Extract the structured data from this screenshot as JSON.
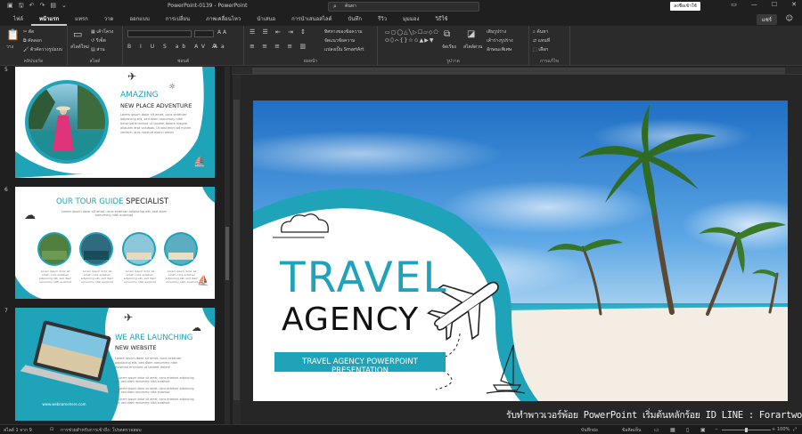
{
  "titlebar": {
    "title": "PowerPoint-0139  -  PowerPoint",
    "search_placeholder": "ค้นหา",
    "signin": "ลงชื่อเข้าใช้"
  },
  "tabs": [
    "ไฟล์",
    "หน้าแรก",
    "แทรก",
    "วาด",
    "ออกแบบ",
    "การเปลี่ยน",
    "ภาพเคลื่อนไหว",
    "นำเสนอ",
    "การนำเสนอสไลด์",
    "บันทึก",
    "รีวิว",
    "มุมมอง",
    "วิธีใช้"
  ],
  "active_tab": "หน้าแรก",
  "share_label": "แชร์",
  "ribbon": {
    "clipboard": {
      "paste": "วาง",
      "cut": "ตัด",
      "copy": "คัดลอก",
      "format_painter": "ตัวคัดวางรูปแบบ",
      "label": "คลิปบอร์ด"
    },
    "slides": {
      "new_slide": "สไลด์ใหม่",
      "layout": "เค้าโครง",
      "reset": "รีเซ็ต",
      "section": "ส่วน",
      "label": "สไลด์"
    },
    "font": {
      "label": "ฟอนต์"
    },
    "paragraph": {
      "direction": "ทิศทางของข้อความ",
      "align": "จัดแนวข้อความ",
      "smartart": "แปลงเป็น SmartArt",
      "label": "ย่อหน้า"
    },
    "drawing": {
      "shapes": "▭▢◯△╲▷☐▱◇⬠\n⬭⬯⌒{}☆✩▲▶▼",
      "arrange": "จัดเรียง",
      "styles": "สไตล์ด่วน",
      "fill": "เติมรูปร่าง",
      "outline": "เค้าร่างรูปร่าง",
      "effects": "ลักษณะพิเศษ",
      "label": "รูปวาด"
    },
    "editing": {
      "find": "ค้นหา",
      "replace": "แทนที่",
      "select": "เลือก",
      "label": "การแก้ไข"
    }
  },
  "thumbnails": [
    {
      "number": "5",
      "title1": "AMAZING",
      "title2": "NEW PLACE ADVENTURE",
      "body": "Lorem ipsum dolor sit amet, cons ectetuer adipiscing elit, sed diam nonummy nibh euismod tincidunt ut laoreet dolore magna aliquam erat volutpat. Ut wisi enim ad minim veniam, quis nostrud exerci tation"
    },
    {
      "number": "6",
      "title1": "OUR TOUR GUIDE",
      "title2": "SPECIALIST",
      "subtitle": "Lorem ipsum dolor sit amet, cons ectetuer adipiscing elit, sed diam nonummy nibh euismod",
      "caption": "Lorem ipsum dolor sit amet, cons ectetuer adipiscing elit, sed diam nonummy nibh euismod"
    },
    {
      "number": "7",
      "title1": "WE ARE LAUNCHING",
      "title2": "NEW WEBSITE",
      "body": "Lorem ipsum dolor sit amet, cons ectetuer adipiscing elit, sed diam nonummy nibh euismod tincidunt ut laoreet dolore",
      "bullet": "Lorem ipsum dolor sit amet, cons ectetuer adipiscing elit, sed diam nonummy nibh euismod",
      "url": "www.webnamehere.com"
    }
  ],
  "mainslide": {
    "title1": "TRAVEL",
    "title2": "AGENCY",
    "banner": "TRAVEL AGENCY POWERPOINT PRESENTATION"
  },
  "status": {
    "slide_count": "สไลด์ 1 จาก 9",
    "accessibility": "การช่วยสำหรับการเข้าถึง: โปรดตรวจสอบ",
    "notes": "บันทึกย่อ",
    "comments": "ข้อคิดเห็น",
    "zoom": "100%"
  },
  "watermark": "รับทำพาวเวอร์พ้อย PowerPoint เริ่มต้นหลักร้อย ID LINE : Forartwork",
  "colors": {
    "teal": "#1ea3b8",
    "dark": "#1f1f1f",
    "ribbon": "#2b2b2b"
  }
}
